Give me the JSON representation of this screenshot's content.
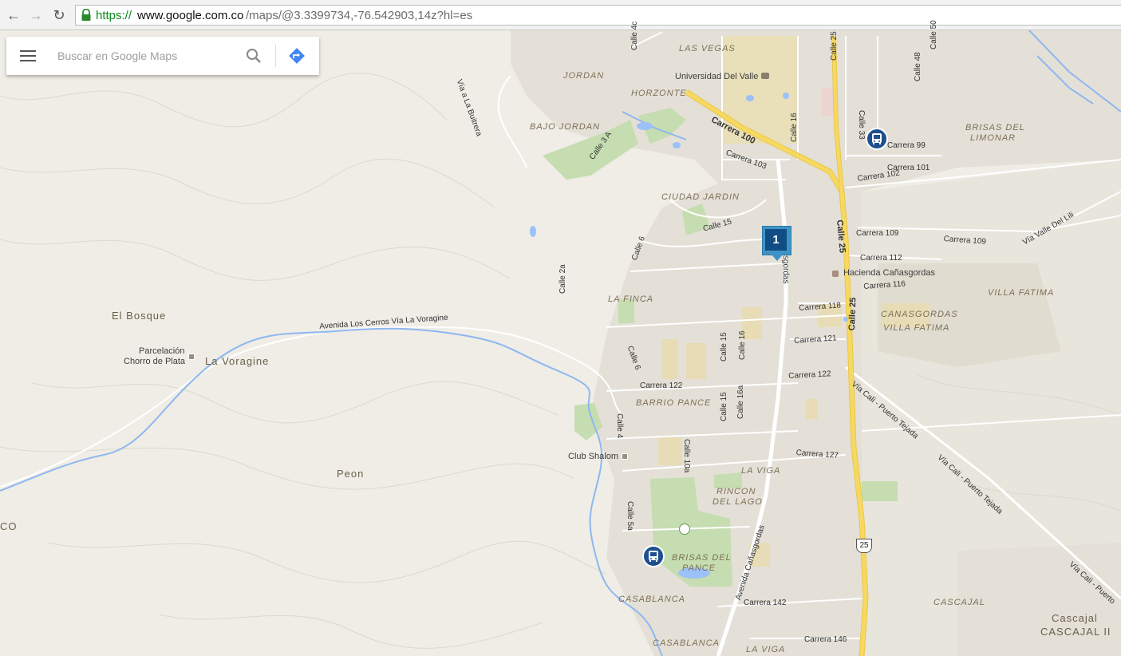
{
  "browser": {
    "url_scheme": "https://",
    "url_host": "www.google.com.co",
    "url_path": "/maps/@3.3399734,-76.542903,14z?hl=es"
  },
  "search": {
    "placeholder": "Buscar en Google Maps"
  },
  "marker": {
    "label": "1"
  },
  "places": {
    "el_bosque": "El Bosque",
    "parcelacion": "Parcelación",
    "chorro_de_plata": "Chorro de Plata",
    "la_voragine": "La Voragine",
    "peon": "Peon",
    "co_edge": "CO",
    "las_vegas": "LAS VEGAS",
    "jordan": "JORDAN",
    "horzonte": "HORZONTE",
    "bajo_jordan": "BAJO JORDAN",
    "universidad": "Universidad Del Valle",
    "ciudad_jardin": "CIUDAD JARDIN",
    "la_finca": "LA FINCA",
    "barrio_pance": "BARRIO PANCE",
    "club_shalom": "Club Shalom",
    "la_viga": "LA VIGA",
    "rincon_del_lago_1": "RINCON",
    "rincon_del_lago_2": "DEL LAGO",
    "brisas_del_pance_1": "BRISAS DEL",
    "brisas_del_pance_2": "PANCE",
    "casablanca": "CASABLANCA",
    "casablanca_2": "CASABLANCA",
    "la_viga_2": "LA VIGA",
    "brisas_limonar_1": "BRISAS DEL",
    "brisas_limonar_2": "LIMONAR",
    "hacienda": "Hacienda Cañasgordas",
    "villa_fatima": "VILLA FATIMA",
    "canasgordas_1": "CANASGORDAS",
    "canasgordas_2": "VILLA FATIMA",
    "cascajal": "CASCAJAL",
    "cascajal_2": "Cascajal",
    "cascajal_ii": "CASCAJAL II"
  },
  "roads": {
    "calle_4c": "Calle 4c",
    "via_buitrera": "Vía a La Buitrera",
    "calle_3a": "Calle 3 A",
    "carrera_100": "Carrera 100",
    "carrera_103": "Carrera 103",
    "calle_16_top": "Calle 16",
    "calle_25_top": "Calle 25",
    "calle_50": "Calle 50",
    "calle_48": "Calle 48",
    "calle_33": "Calle 33",
    "carrera_99": "Carrera 99",
    "carrera_101": "Carrera 101",
    "carrera_102": "Carrera 102",
    "calle_15": "Calle 15",
    "calle_6": "Calle 6",
    "calle_2a": "Calle 2a",
    "canasgordas": "Cañasgordas",
    "calle_25": "Calle 25",
    "carrera_109": "Carrera 109",
    "carrera_109b": "Carrera 109",
    "via_valle_lili": "Vía Valle Del Lili",
    "carrera_112": "Carrera 112",
    "carrera_116": "Carrera 116",
    "carrera_118": "Carrera 118",
    "av_los_cerros": "Avenida Los Cerros Vía La Voragine",
    "calle_6b": "Calle 6",
    "calle_15b": "Calle 15",
    "calle_16b": "Calle 16",
    "carrera_121": "Carrera 121",
    "carrera_122": "Carrera 122",
    "carrera_122b": "Carrera 122",
    "calle_15c": "Calle 15",
    "calle_16a": "Calle 16a",
    "calle_4": "Calle 4",
    "calle_10a": "Calle 10a",
    "carrera_127": "Carrera 127",
    "via_puerto_tejada_1": "Vía Cali - Puerto Tejada",
    "via_puerto_tejada_2": "Vía Cali - Puerto Tejada",
    "via_puerto_tejada_3": "Vía Cali - Puerto",
    "calle_5a": "Calle 5a",
    "av_canasgordas": "Avenida Cañasgordas",
    "carrera_142": "Carrera 142",
    "carrera_146": "Carrera 146",
    "shield_25": "25"
  },
  "colors": {
    "land": "#efede6",
    "urban": "#e3dfd5",
    "park": "#c8dfb4",
    "water": "#9cc0f9",
    "highway": "#f7d457",
    "road": "#ffffff",
    "marker": "#0f4d84"
  }
}
